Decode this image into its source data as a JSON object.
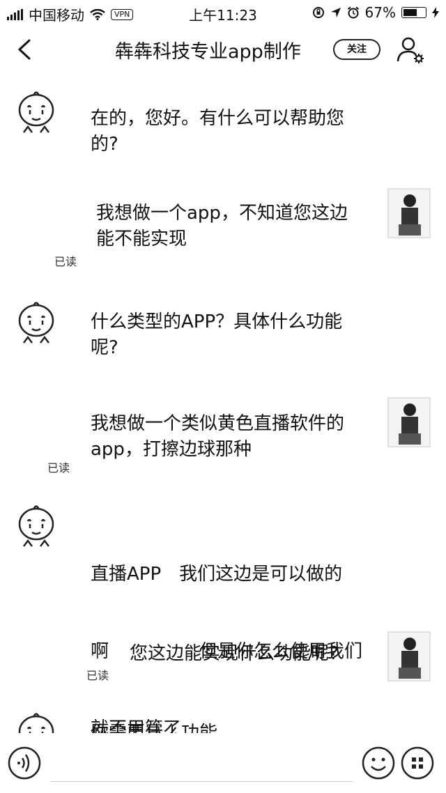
{
  "status_bar": {
    "carrier": "中国移动",
    "vpn": "VPN",
    "time": "上午11:23",
    "battery": "67%",
    "battery_level": 0.67
  },
  "header": {
    "title": "犇犇科技专业app制作",
    "follow_label": "关注"
  },
  "messages": [
    {
      "side": "left",
      "text_lines": [
        "在的，您好。有什么可以帮助您",
        "的?"
      ]
    },
    {
      "side": "right",
      "text_lines": [
        "我想做一个app，不知道您这边",
        "能不能实现"
      ],
      "read_label": "已读"
    },
    {
      "side": "left",
      "text_lines": [
        "什么类型的APP？具体什么功能",
        "呢?"
      ]
    },
    {
      "side": "right",
      "text_lines": [
        "我想做一个类似黄色直播软件的",
        "app，打擦边球那种"
      ],
      "read_label": "已读"
    },
    {
      "side": "left",
      "text_lines": [
        "直播APP　我们这边是可以做的",
        "啊　　　　　但是你怎么使用我们",
        "就不用管了"
      ]
    },
    {
      "side": "right",
      "text_lines": [
        "您这边能实现什么功能呢?"
      ],
      "read_label": "已读"
    },
    {
      "side": "left",
      "text_lines": [
        "你需要什么功能"
      ]
    }
  ],
  "input": {
    "value": "",
    "placeholder": ""
  },
  "icons": {
    "back": "chevron-left-icon",
    "profile_settings": "user-gear-icon",
    "voice": "voice-icon",
    "emoji": "emoji-icon",
    "more": "more-icon"
  }
}
